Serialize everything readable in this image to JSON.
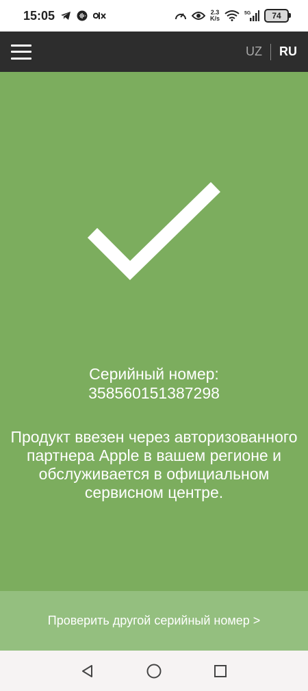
{
  "status_bar": {
    "time": "15:05",
    "net_speed_value": "2.3",
    "net_speed_unit": "K/s",
    "battery": "74",
    "icons": [
      "telegram-icon",
      "voice-icon",
      "olx-icon",
      "speedometer-icon",
      "eye-icon",
      "wifi-icon",
      "signal-icon",
      "battery-icon"
    ]
  },
  "header": {
    "lang_uz": "UZ",
    "lang_ru": "RU",
    "active_lang": "RU"
  },
  "result": {
    "serial_label": "Серийный номер:",
    "serial_value": "358560151387298",
    "message": "Продукт ввезен через авторизованного партнера Apple в вашем регионе и обслуживается в официальном сервисном центре."
  },
  "footer": {
    "check_another": "Проверить другой серийный номер >"
  },
  "colors": {
    "app_bar": "#2d2d2d",
    "success_green": "#7cad5e",
    "footer_green": "#94bf7f"
  }
}
